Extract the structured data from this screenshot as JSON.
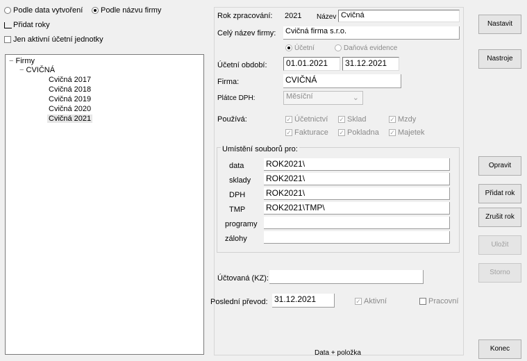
{
  "top": {
    "radio_by_date": "Podle data vytvoření",
    "radio_by_company": "Podle názvu firmy",
    "check_show_years": "Přidat roky",
    "check_show_inactive": "Jen aktivní účetní jednotky"
  },
  "tree": {
    "root": "Firmy",
    "company": "CVIČNÁ",
    "years": [
      "Cvičná 2017",
      "Cvičná 2018",
      "Cvičná 2019",
      "Cvičná 2020",
      "Cvičná 2021"
    ],
    "selected_index": 4
  },
  "form": {
    "rok_label": "Rok zpracování:",
    "rok_value": "2021",
    "nazev_label": "Název",
    "nazev_value": "Cvičná",
    "plny_label": "Celý název firmy:",
    "plny_value": "Cvičná firma s.r.o.",
    "rok_type1": "Účetní",
    "rok_type2": "Daňová evidence",
    "obdobi_label": "Účetní období:",
    "obdobi_from": "01.01.2021",
    "obdobi_to": "31.12.2021",
    "firma_label": "Firma:",
    "firma_value": "CVIČNÁ",
    "dph_label": "Plátce DPH:",
    "dph_value": "Měsíční",
    "moduly_label": "Používá:",
    "moduly": [
      "Účetnictví",
      "Sklad",
      "Mzdy",
      "Fakturace",
      "Pokladna",
      "Majetek"
    ],
    "umisteni_label": "Umístění souborů pro:",
    "paths": [
      {
        "label": "data",
        "value": "ROK2021\\"
      },
      {
        "label": "sklady",
        "value": "ROK2021\\"
      },
      {
        "label": "DPH",
        "value": "ROK2021\\"
      },
      {
        "label": "TMP",
        "value": "ROK2021\\TMP\\"
      },
      {
        "label": "programy",
        "value": ""
      },
      {
        "label": "zálohy",
        "value": ""
      }
    ],
    "ucet_label": "Účtovaná (KZ):",
    "ucet_value": "",
    "posledni_label": "Poslední převod:",
    "posledni_value": "31.12.2021",
    "aktivni_label": "Aktivní",
    "pracovni_label": "Pracovní",
    "footer_label": "Data + položka"
  },
  "buttons": {
    "nastavit": "Nastavit",
    "nastroj": "Nastroje",
    "opravit": "Opravit",
    "pridat": "Přidat rok",
    "zrusit": "Zrušit rok",
    "ulozit": "Uložit",
    "storno": "Storno",
    "konec": "Konec"
  }
}
